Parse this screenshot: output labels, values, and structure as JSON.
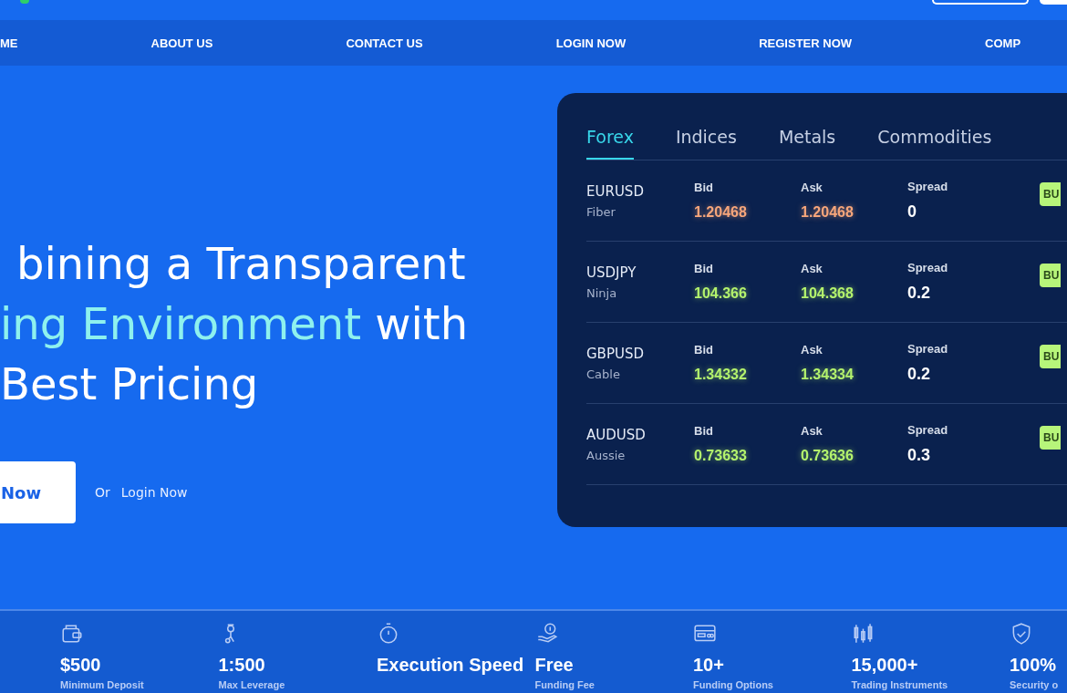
{
  "nav": {
    "items": [
      "ME",
      "ABOUT US",
      "CONTACT US",
      "LOGIN NOW",
      "REGISTER NOW",
      "COMP"
    ]
  },
  "hero": {
    "title_lines": [
      [
        {
          "text": "bining a Transparent",
          "highlight": false
        }
      ],
      [
        {
          "text": "ing Environment",
          "highlight": true
        },
        {
          "text": " with",
          "highlight": false
        }
      ],
      [
        {
          "text": "Best Pricing",
          "highlight": false
        }
      ]
    ],
    "primary_button": "Now",
    "or_text": "Or",
    "login_link": "Login Now"
  },
  "quotes": {
    "tabs": [
      {
        "label": "Forex",
        "selected": true
      },
      {
        "label": "Indices",
        "selected": false
      },
      {
        "label": "Metals",
        "selected": false
      },
      {
        "label": "Commodities",
        "selected": false
      }
    ],
    "rows": [
      {
        "symbol": "EURUSD",
        "nickname": "Fiber",
        "bid_label": "Bid",
        "bid": "1.20468",
        "ask_label": "Ask",
        "ask": "1.20468",
        "spread_label": "Spread",
        "spread": "0",
        "rising": false,
        "action": "BU"
      },
      {
        "symbol": "USDJPY",
        "nickname": "Ninja",
        "bid_label": "Bid",
        "bid": "104.366",
        "ask_label": "Ask",
        "ask": "104.368",
        "spread_label": "Spread",
        "spread": "0.2",
        "rising": true,
        "action": "BU"
      },
      {
        "symbol": "GBPUSD",
        "nickname": "Cable",
        "bid_label": "Bid",
        "bid": "1.34332",
        "ask_label": "Ask",
        "ask": "1.34334",
        "spread_label": "Spread",
        "spread": "0.2",
        "rising": true,
        "action": "BU"
      },
      {
        "symbol": "AUDUSD",
        "nickname": "Aussie",
        "bid_label": "Bid",
        "bid": "0.73633",
        "ask_label": "Ask",
        "ask": "0.73636",
        "spread_label": "Spread",
        "spread": "0.3",
        "rising": true,
        "action": "BU"
      }
    ]
  },
  "stats": [
    {
      "value": "$500",
      "label": "Minimum Deposit"
    },
    {
      "value": "1:500",
      "label": "Max Leverage"
    },
    {
      "value": "Execution Speed"
    },
    {
      "value": "Free",
      "label": "Funding Fee"
    },
    {
      "value": "10+",
      "label": "Funding Options"
    },
    {
      "value": "15,000+",
      "label": "Trading Instruments"
    },
    {
      "value": "100%",
      "label": "Security o"
    }
  ]
}
